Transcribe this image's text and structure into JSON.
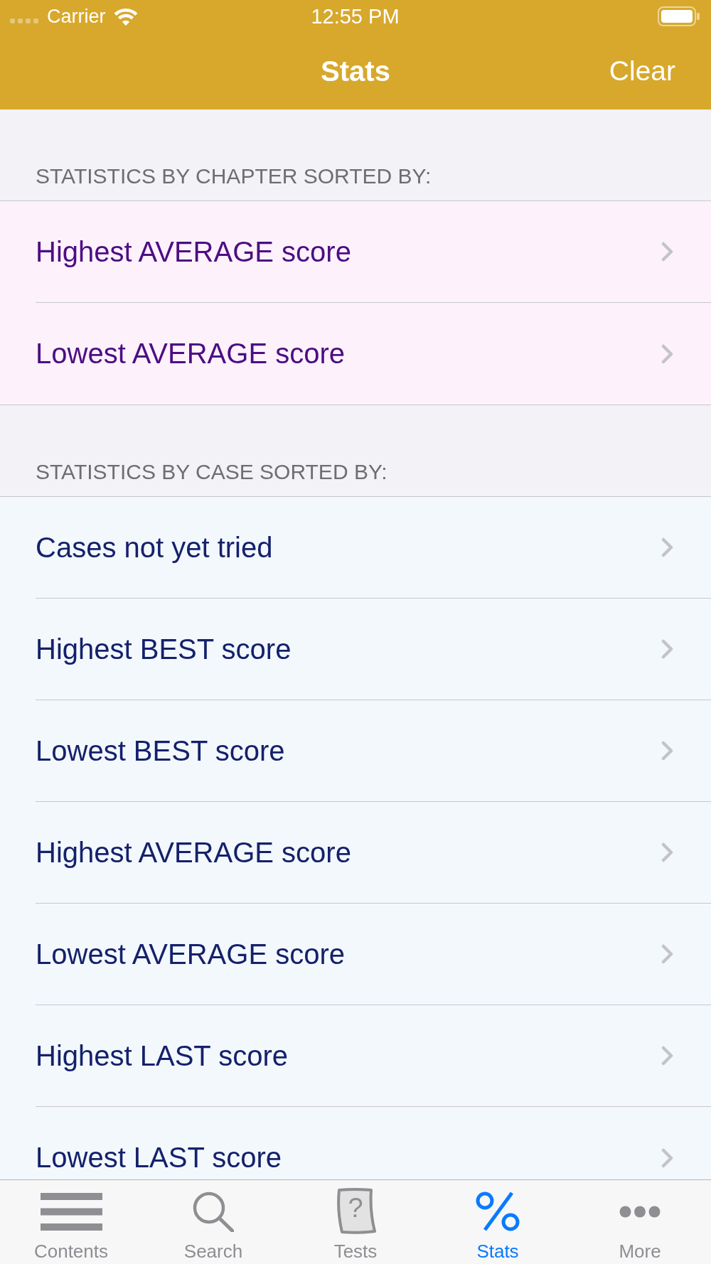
{
  "status_bar": {
    "carrier": "Carrier",
    "time": "12:55 PM"
  },
  "nav_bar": {
    "title": "Stats",
    "right_button": "Clear"
  },
  "sections": [
    {
      "kind": "chapter",
      "header": "STATISTICS BY CHAPTER SORTED BY:",
      "rows": [
        {
          "label": "Highest AVERAGE score"
        },
        {
          "label": "Lowest AVERAGE score"
        }
      ]
    },
    {
      "kind": "case",
      "header": "STATISTICS BY CASE SORTED BY:",
      "rows": [
        {
          "label": "Cases not yet tried"
        },
        {
          "label": "Highest BEST score"
        },
        {
          "label": "Lowest BEST score"
        },
        {
          "label": "Highest AVERAGE score"
        },
        {
          "label": "Lowest AVERAGE score"
        },
        {
          "label": "Highest LAST score"
        },
        {
          "label": "Lowest LAST score"
        }
      ]
    }
  ],
  "tab_bar": {
    "tabs": [
      {
        "label": "Contents",
        "selected": false
      },
      {
        "label": "Search",
        "selected": false
      },
      {
        "label": "Tests",
        "selected": false,
        "icon_mark": "?"
      },
      {
        "label": "Stats",
        "selected": true
      },
      {
        "label": "More",
        "selected": false
      }
    ]
  }
}
